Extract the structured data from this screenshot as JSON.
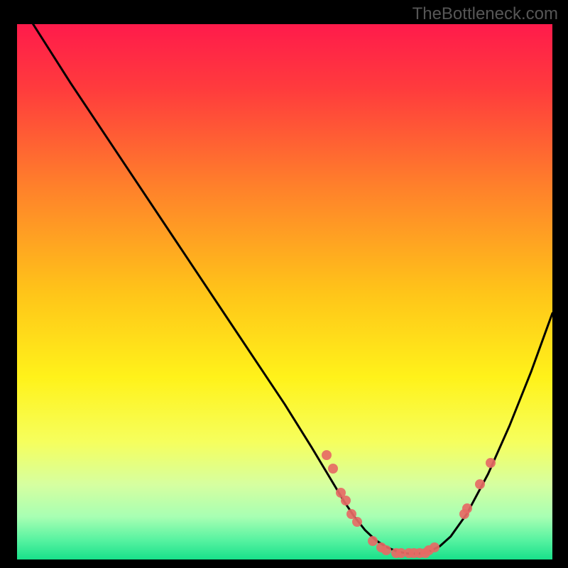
{
  "watermark": "TheBottleneck.com",
  "colors": {
    "dot": "#e66a65",
    "curve": "#000000"
  },
  "chart_data": {
    "type": "line",
    "title": "",
    "xlabel": "",
    "ylabel": "",
    "xlim": [
      0,
      100
    ],
    "ylim": [
      0,
      100
    ],
    "gradient_stops": [
      {
        "t": 0.0,
        "color": "#ff1b4b"
      },
      {
        "t": 0.12,
        "color": "#ff3b3d"
      },
      {
        "t": 0.3,
        "color": "#ff7f2b"
      },
      {
        "t": 0.5,
        "color": "#ffc419"
      },
      {
        "t": 0.66,
        "color": "#fff21a"
      },
      {
        "t": 0.78,
        "color": "#f6ff5d"
      },
      {
        "t": 0.86,
        "color": "#d6ffa0"
      },
      {
        "t": 0.92,
        "color": "#a8ffb3"
      },
      {
        "t": 0.965,
        "color": "#55f2a0"
      },
      {
        "t": 1.0,
        "color": "#18e08a"
      }
    ],
    "series": [
      {
        "name": "bottleneck-curve",
        "x": [
          3,
          10,
          20,
          30,
          40,
          50,
          55,
          58,
          61,
          63,
          65,
          67,
          69,
          71,
          73,
          75,
          77,
          79,
          81,
          84,
          88,
          92,
          96,
          100
        ],
        "y": [
          100,
          89,
          74,
          59,
          44,
          29,
          21,
          16,
          11,
          8,
          5.5,
          3.6,
          2.3,
          1.5,
          1.1,
          1.1,
          1.5,
          2.5,
          4.3,
          8.5,
          16,
          25,
          35,
          46
        ]
      }
    ],
    "dots": [
      {
        "x": 57.8,
        "y": 19.5
      },
      {
        "x": 59.0,
        "y": 17.0
      },
      {
        "x": 60.5,
        "y": 12.5
      },
      {
        "x": 61.4,
        "y": 11.0
      },
      {
        "x": 62.5,
        "y": 8.5
      },
      {
        "x": 63.5,
        "y": 7.0
      },
      {
        "x": 66.5,
        "y": 3.5
      },
      {
        "x": 68.0,
        "y": 2.3
      },
      {
        "x": 69.0,
        "y": 1.7
      },
      {
        "x": 70.8,
        "y": 1.2
      },
      {
        "x": 71.8,
        "y": 1.2
      },
      {
        "x": 73.2,
        "y": 1.2
      },
      {
        "x": 74.1,
        "y": 1.2
      },
      {
        "x": 75.2,
        "y": 1.2
      },
      {
        "x": 76.2,
        "y": 1.2
      },
      {
        "x": 76.9,
        "y": 1.7
      },
      {
        "x": 78.0,
        "y": 2.2
      },
      {
        "x": 83.5,
        "y": 8.5
      },
      {
        "x": 84.1,
        "y": 9.5
      },
      {
        "x": 86.5,
        "y": 14.0
      },
      {
        "x": 88.5,
        "y": 18.0
      }
    ]
  }
}
